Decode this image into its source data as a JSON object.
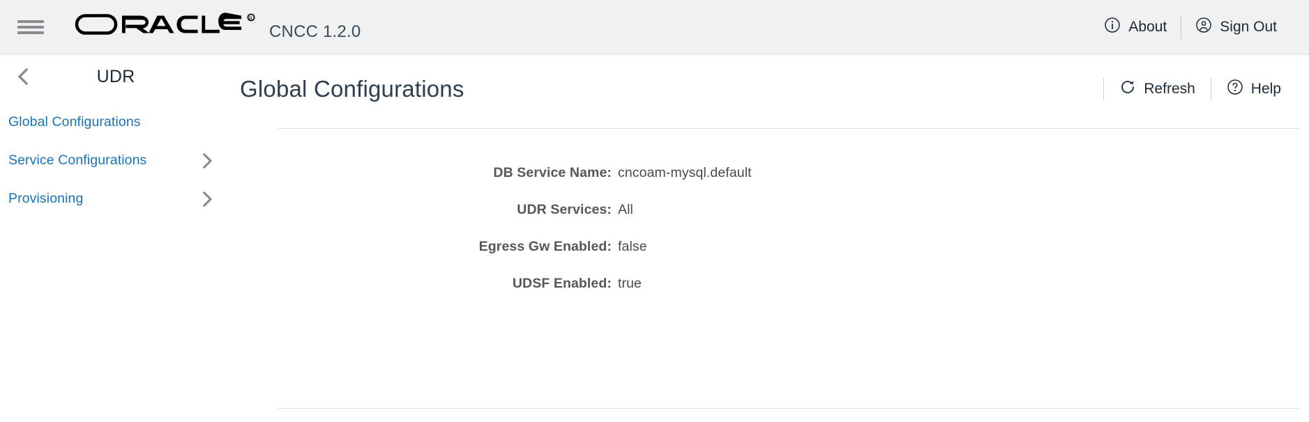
{
  "topbar": {
    "menu_icon": "hamburger-icon",
    "logo_text": "ORACLE",
    "registered_mark": "®",
    "product": "CNCC 1.2.0",
    "actions": [
      {
        "label": "About",
        "icon": "info-circle-icon"
      },
      {
        "label": "Sign Out",
        "icon": "user-circle-icon"
      }
    ]
  },
  "sidebar": {
    "back_icon": "chevron-left-icon",
    "title": "UDR",
    "items": [
      {
        "label": "Global Configurations",
        "has_chevron": false,
        "icon": ""
      },
      {
        "label": "Service Configurations",
        "has_chevron": true,
        "icon": "chevron-right-icon"
      },
      {
        "label": "Provisioning",
        "has_chevron": true,
        "icon": "chevron-right-icon"
      }
    ]
  },
  "main": {
    "page_title": "Global Configurations",
    "actions": [
      {
        "label": "Refresh",
        "icon": "refresh-icon"
      },
      {
        "label": "Help",
        "icon": "help-circle-icon"
      }
    ],
    "details": [
      {
        "label": "DB Service Name:",
        "value": "cncoam-mysql.default"
      },
      {
        "label": "UDR Services:",
        "value": "All"
      },
      {
        "label": "Egress Gw Enabled:",
        "value": "false"
      },
      {
        "label": "UDSF Enabled:",
        "value": "true"
      }
    ]
  },
  "colors": {
    "topbar_bg": "#f1f1f1",
    "link_blue": "#1a72b8",
    "label_gray": "#575757",
    "value_gray": "#4a4a4a",
    "title_gray": "#2c3e50",
    "divider": "#e0e0e0"
  }
}
